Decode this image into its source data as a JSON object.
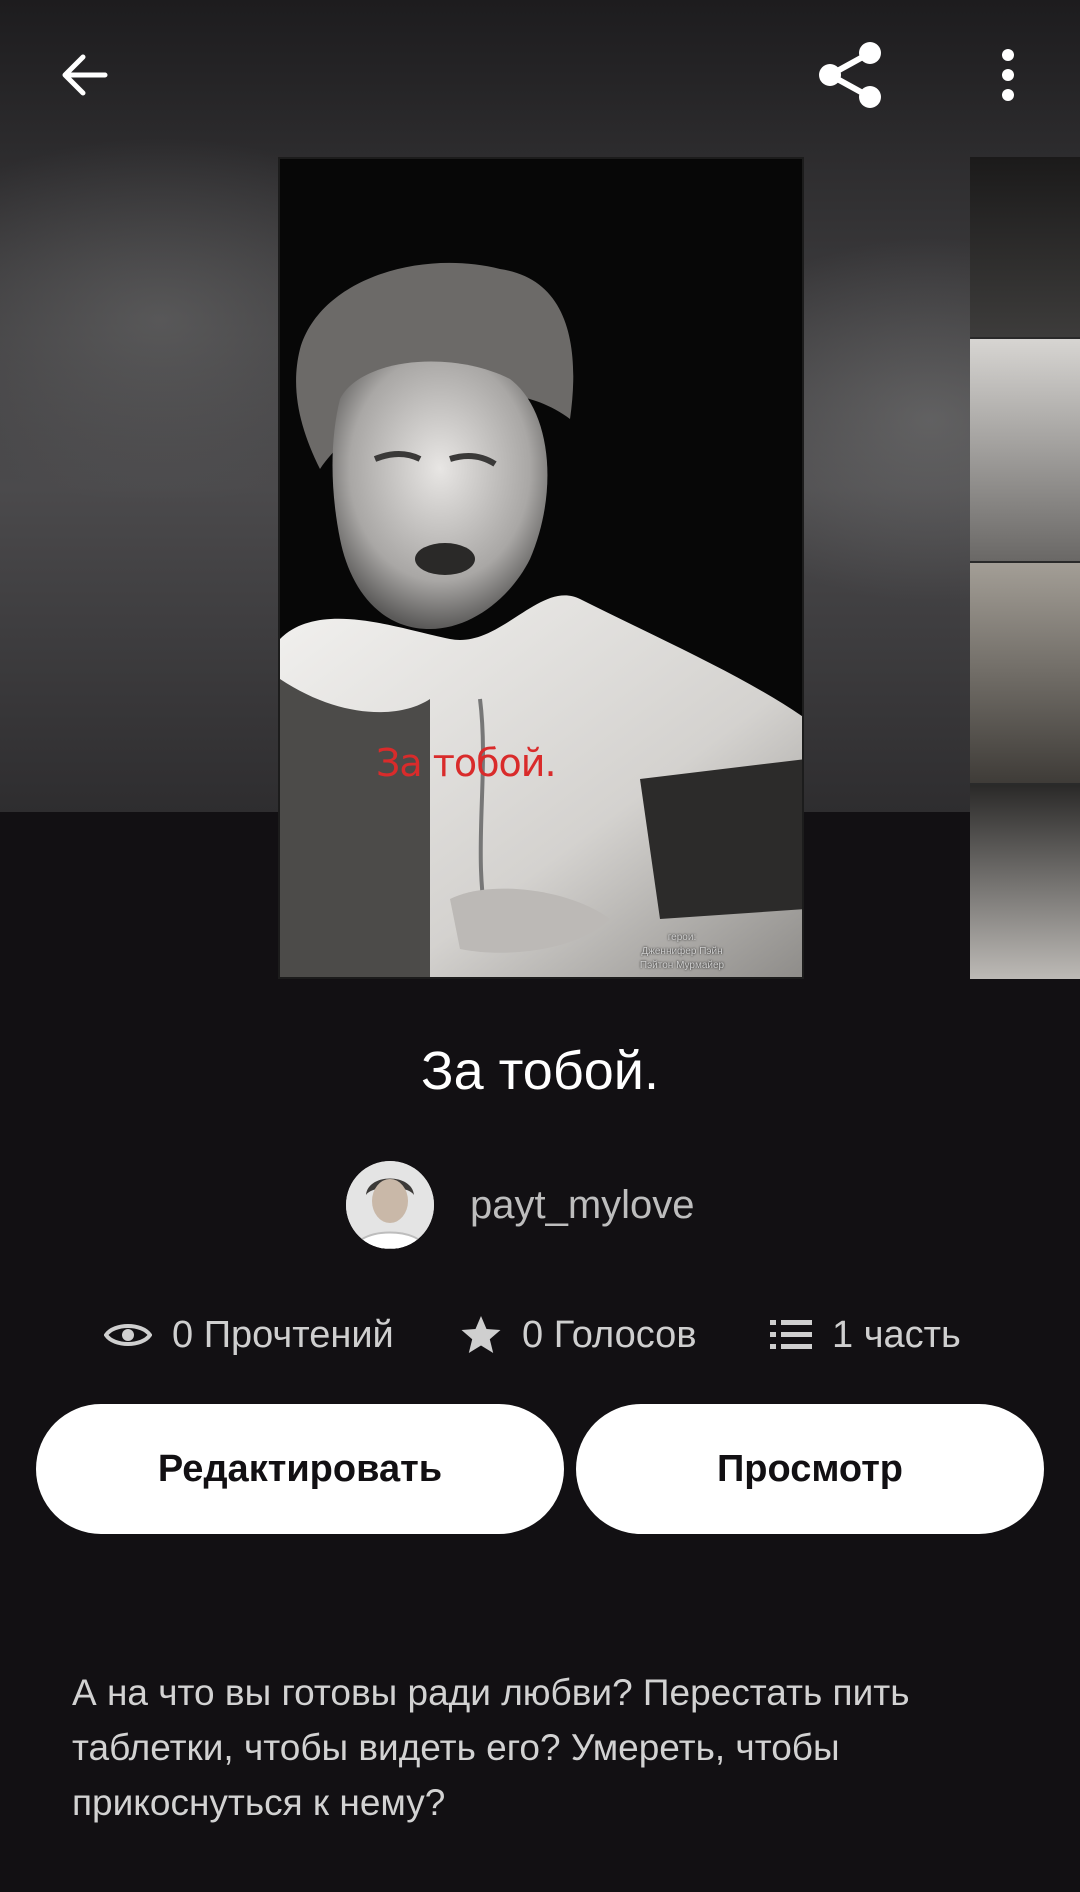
{
  "topbar": {
    "back_icon": "arrow-left-icon",
    "share_icon": "share-icon",
    "more_icon": "more-vertical-icon"
  },
  "cover": {
    "title_text": "За тобой.",
    "credits": [
      "герои:",
      "Дженнифер Пэйн",
      "Пэйтон Мурмайер"
    ]
  },
  "story": {
    "title": "За тобой.",
    "author": "payt_mylove",
    "stats": {
      "reads": "0 Прочтений",
      "votes": "0 Голосов",
      "parts": "1 часть"
    },
    "edit_label": "Редактировать",
    "view_label": "Просмотр",
    "description": "А на что вы готовы ради любви? Перестать пить таблетки, чтобы видеть его? Умереть, чтобы прикоснуться к нему?"
  },
  "colors": {
    "background": "#121013",
    "button": "#ffffff",
    "cover_title": "#d92b2b"
  }
}
